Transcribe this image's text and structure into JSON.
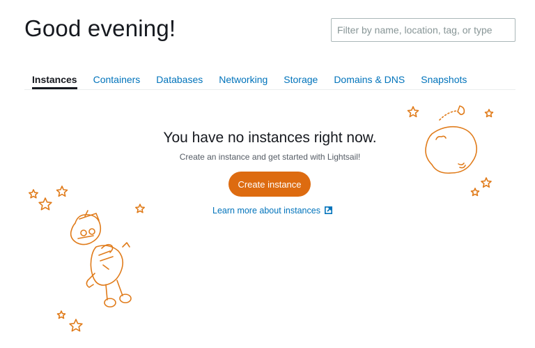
{
  "header": {
    "greeting": "Good evening!",
    "filter_placeholder": "Filter by name, location, tag, or type"
  },
  "tabs": [
    {
      "label": "Instances",
      "active": true
    },
    {
      "label": "Containers",
      "active": false
    },
    {
      "label": "Databases",
      "active": false
    },
    {
      "label": "Networking",
      "active": false
    },
    {
      "label": "Storage",
      "active": false
    },
    {
      "label": "Domains & DNS",
      "active": false
    },
    {
      "label": "Snapshots",
      "active": false
    }
  ],
  "empty_state": {
    "title": "You have no instances right now.",
    "subtitle": "Create an instance and get started with Lightsail!",
    "create_button": "Create instance",
    "learn_more": "Learn more about instances",
    "learn_more_icon": "external-link-icon"
  },
  "colors": {
    "accent": "#dd6b10",
    "link": "#0073bb",
    "text": "#16191f",
    "illustration": "#e07b1a"
  }
}
